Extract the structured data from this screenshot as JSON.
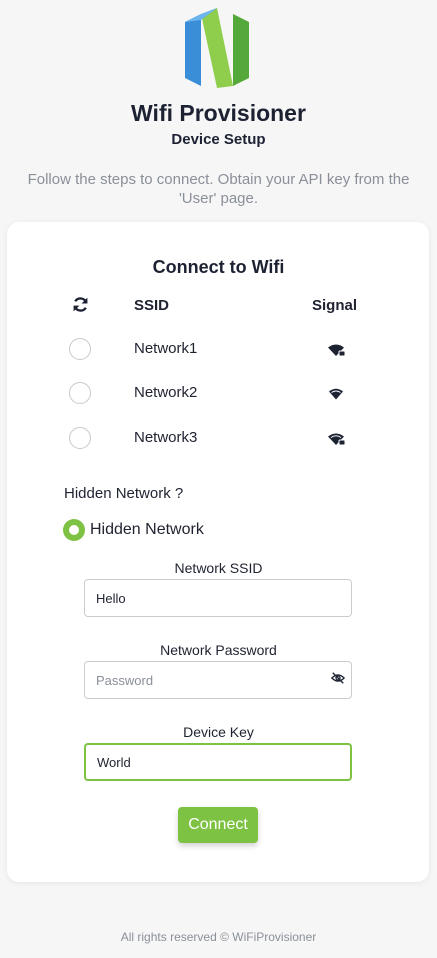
{
  "header": {
    "logo_icon": "n-logo-icon",
    "title": "Wifi Provisioner",
    "subtitle": "Device Setup",
    "instructions": "Follow the steps to connect. Obtain your API key from the 'User' page."
  },
  "card": {
    "title": "Connect to Wifi",
    "refresh_icon": "refresh-icon",
    "col_ssid": "SSID",
    "col_signal": "Signal",
    "networks": [
      {
        "ssid": "Network1",
        "signal_icon": "wifi-locked-icon",
        "selected": false
      },
      {
        "ssid": "Network2",
        "signal_icon": "wifi-icon",
        "selected": false
      },
      {
        "ssid": "Network3",
        "signal_icon": "wifi-locked-icon",
        "selected": false
      }
    ],
    "hidden_question": "Hidden Network ?",
    "hidden_option_label": "Hidden Network",
    "hidden_selected": true,
    "ssid_label": "Network SSID",
    "ssid_value": "Hello",
    "password_label": "Network Password",
    "password_placeholder": "Password",
    "password_value": "",
    "password_toggle_icon": "eye-off-icon",
    "device_key_label": "Device Key",
    "device_key_value": "World",
    "connect_label": "Connect"
  },
  "footer": {
    "text": "All rights reserved © WiFiProvisioner"
  },
  "colors": {
    "accent": "#7dc242",
    "logo_green": "#7dc242",
    "logo_blue": "#3a8ed8",
    "text_dark": "#1d2233",
    "text_muted": "#8a8f99"
  }
}
